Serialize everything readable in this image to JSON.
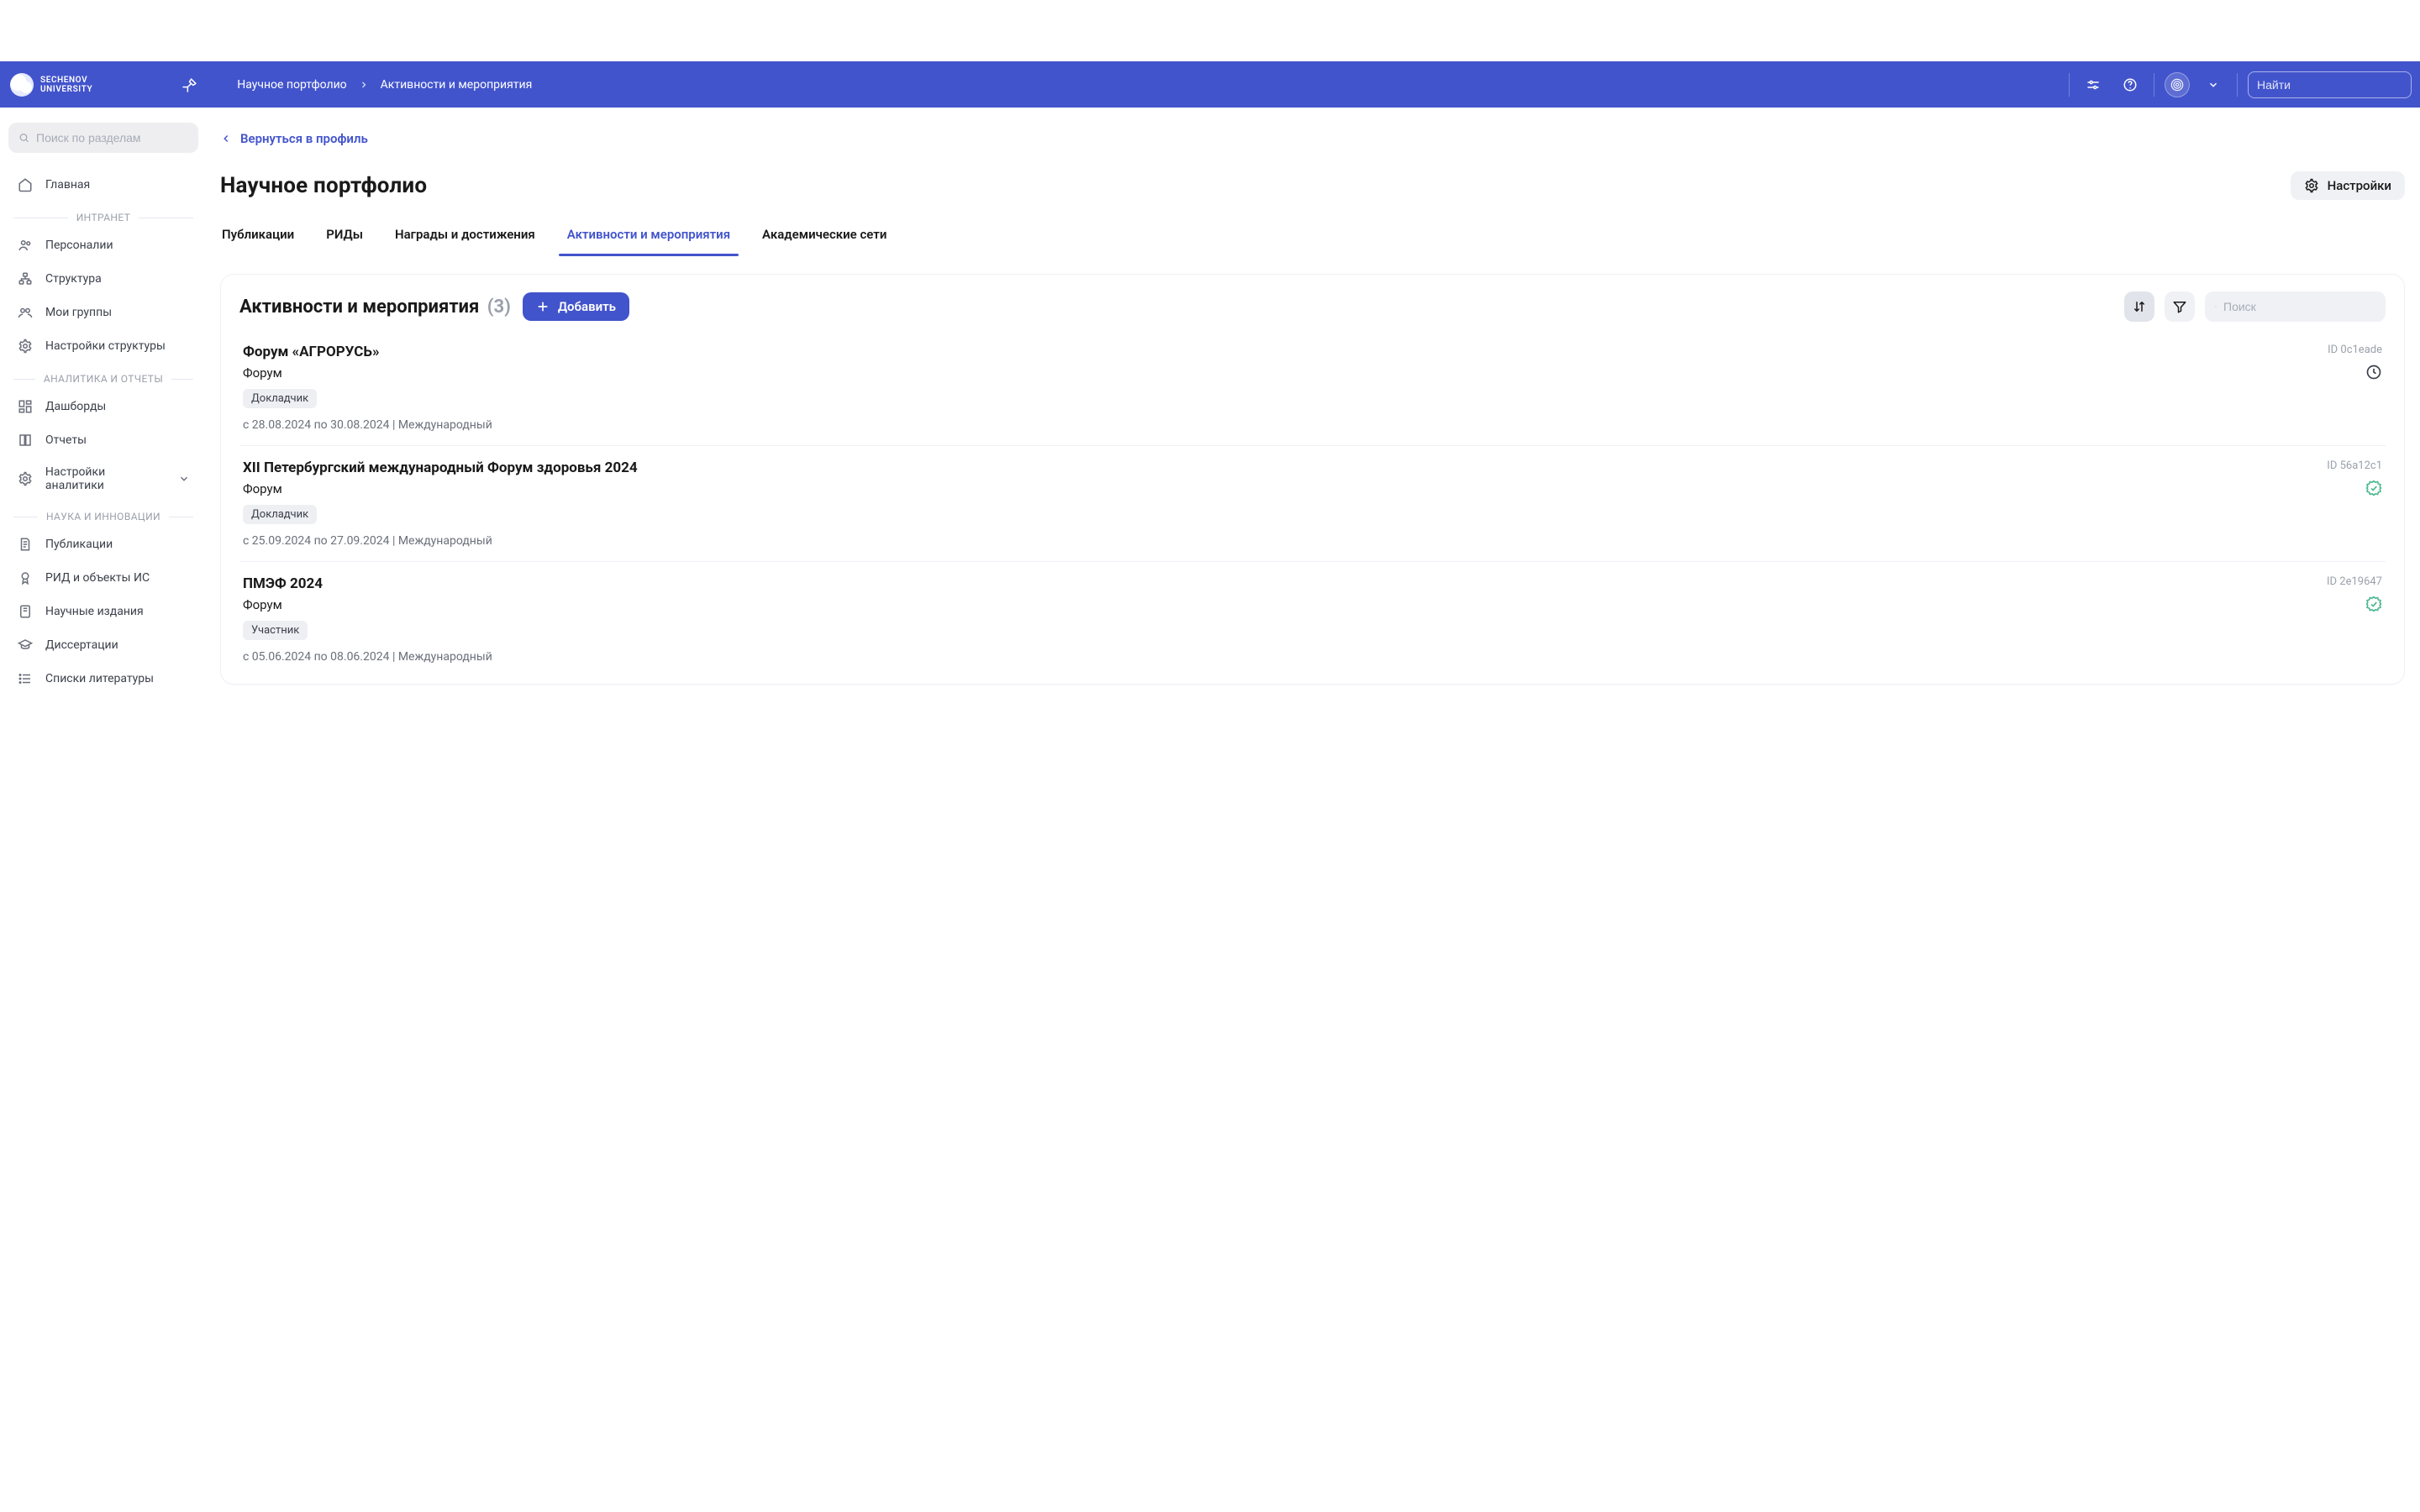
{
  "brand": {
    "line1": "SECHENOV",
    "line2": "UNIVERSITY"
  },
  "breadcrumb": {
    "root": "Научное портфолио",
    "leaf": "Активности и мероприятия"
  },
  "topbar": {
    "search_placeholder": "Найти"
  },
  "sidebar": {
    "search_placeholder": "Поиск по разделам",
    "home": "Главная",
    "sections": [
      {
        "label": "ИНТРАНЕТ",
        "items": [
          "Персоналии",
          "Структура",
          "Мои группы",
          "Настройки структуры"
        ]
      },
      {
        "label": "АНАЛИТИКА И ОТЧЕТЫ",
        "items": [
          "Дашборды",
          "Отчеты",
          "Настройки аналитики"
        ]
      },
      {
        "label": "НАУКА И ИННОВАЦИИ",
        "items": [
          "Публикации",
          "РИД и объекты ИС",
          "Научные издания",
          "Диссертации",
          "Списки литературы"
        ]
      }
    ]
  },
  "backlink": "Вернуться в профиль",
  "page_title": "Научное портфолио",
  "settings_label": "Настройки",
  "tabs": [
    "Публикации",
    "РИДы",
    "Награды и достижения",
    "Активности и мероприятия",
    "Академические сети"
  ],
  "active_tab_index": 3,
  "panel": {
    "title": "Активности и мероприятия",
    "count": "(3)",
    "add_label": "Добавить",
    "search_placeholder": "Поиск"
  },
  "items": [
    {
      "title": "Форум «АГРОРУСЬ»",
      "id_label": "ID 0c1eade",
      "type": "Форум",
      "role": "Докладчик",
      "meta": "с 28.08.2024 по 30.08.2024 | Международный",
      "status": "pending"
    },
    {
      "title": "XII Петербургский международный Форум здоровья 2024",
      "id_label": "ID 56a12c1",
      "type": "Форум",
      "role": "Докладчик",
      "meta": "с 25.09.2024 по 27.09.2024 | Международный",
      "status": "verified"
    },
    {
      "title": "ПМЭФ 2024",
      "id_label": "ID 2e19647",
      "type": "Форум",
      "role": "Участник",
      "meta": "с 05.06.2024 по 08.06.2024 | Международный",
      "status": "verified"
    }
  ]
}
